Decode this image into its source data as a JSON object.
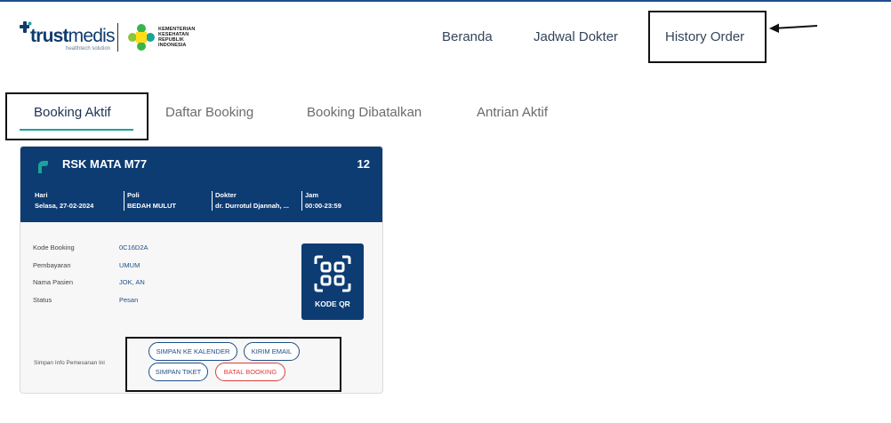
{
  "brand": {
    "name_bold": "trust",
    "name_light": "medis",
    "tagline": "healthtech solution",
    "partner_lines": [
      "KEMENTERIAN",
      "KESEHATAN",
      "REPUBLIK",
      "INDONESIA"
    ]
  },
  "nav": {
    "items": [
      {
        "label": "Beranda"
      },
      {
        "label": "Jadwal Dokter"
      },
      {
        "label": "History Order"
      }
    ]
  },
  "tabs": [
    {
      "label": "Booking Aktif",
      "active": true
    },
    {
      "label": "Daftar Booking",
      "active": false
    },
    {
      "label": "Booking Dibatalkan",
      "active": false
    },
    {
      "label": "Antrian Aktif",
      "active": false
    }
  ],
  "booking": {
    "clinic": "RSK MATA M77",
    "count": "12",
    "header_fields": [
      {
        "label": "Hari",
        "value": "Selasa, 27-02-2024"
      },
      {
        "label": "Poli",
        "value": "BEDAH MULUT"
      },
      {
        "label": "Dokter",
        "value": "dr. Durrotul Djannah, ..."
      },
      {
        "label": "Jam",
        "value": "00:00-23:59"
      }
    ],
    "details": [
      {
        "label": "Kode Booking",
        "value": "0C16D2A"
      },
      {
        "label": "Pembayaran",
        "value": "UMUM"
      },
      {
        "label": "Nama Pasien",
        "value": "JOK, AN"
      },
      {
        "label": "Status",
        "value": "Pesan"
      }
    ],
    "qr_label": "KODE QR",
    "save_info_label": "Simpan Info Pemesanan Ini",
    "actions": {
      "calendar": "SIMPAN KE KALENDER",
      "email": "KIRIM EMAIL",
      "ticket": "SIMPAN TIKET",
      "cancel": "BATAL BOOKING"
    }
  },
  "colors": {
    "primary": "#0d3c73",
    "accent": "#1aa39a",
    "danger": "#e03a3a"
  },
  "icons": {
    "brand_mark": "trustmedis-cross-icon",
    "partner_logo": "kemenkes-logo-icon",
    "clinic": "clinic-leaf-icon",
    "qr": "qr-code-icon",
    "annotation": "arrow-left-icon"
  }
}
